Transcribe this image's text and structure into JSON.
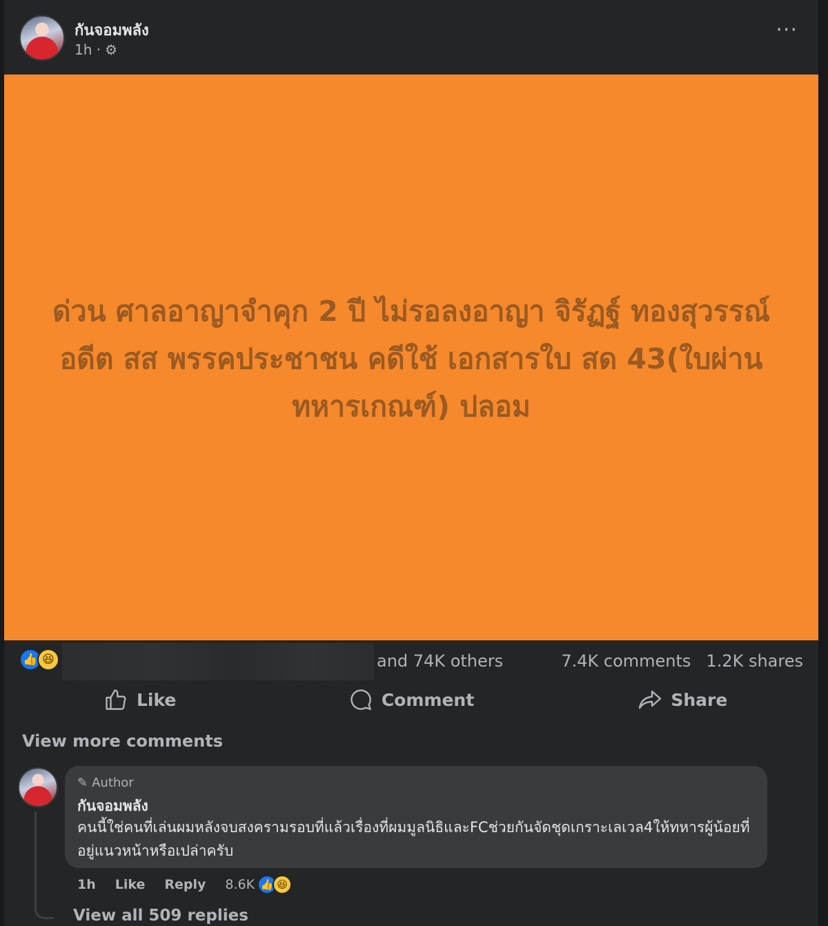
{
  "post": {
    "author": "กันจอมพลัง",
    "time": "1h ·",
    "more_label": "···",
    "panel_text": "ด่วน ศาลอาญาจำคุก 2 ปี ไม่รอลงอาญา จิรัฏฐ์ ทองสุวรรณ์ อดีต สส พรรคประชาชน คดีใช้ เอกสารใบ สด 43(ใบผ่านทหารเกณฑ์) ปลอม",
    "panel_color": "#f6892b"
  },
  "stats": {
    "others": "and 74K others",
    "comments": "7.4K comments",
    "shares": "1.2K shares",
    "reaction_icons": [
      "like-icon",
      "haha-icon"
    ]
  },
  "actions": {
    "like": "Like",
    "comment": "Comment",
    "share": "Share"
  },
  "view_more_comments": "View more comments",
  "comment": {
    "badge": "Author",
    "author": "กันจอมพลัง",
    "text": "คนนี้ใช่คนที่เล่นผมหลังจบสงครามรอบที่แล้วเรื่องที่ผมมูลนิธิและFCช่วยกันจัดชุดเกราะเลเวล4ให้ทหารผู้น้อยที่อยู่แนวหน้าหรือเปล่าครับ",
    "time": "1h",
    "like": "Like",
    "reply": "Reply",
    "reaction_count": "8.6K",
    "view_replies": "View all 509 replies"
  }
}
